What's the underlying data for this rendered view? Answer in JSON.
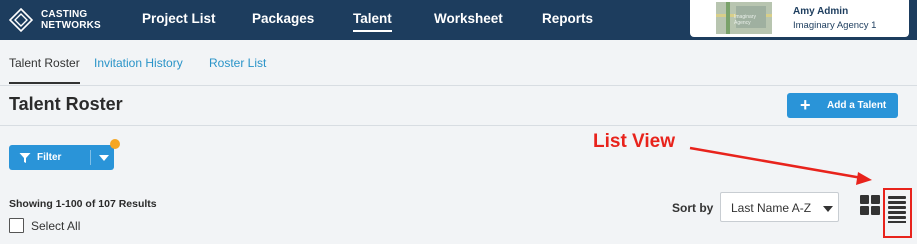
{
  "brand": {
    "line1": "CASTING",
    "line2": "NETWORKS",
    "icon": "casting-networks-logo-icon"
  },
  "nav": {
    "items": [
      {
        "label": "Project List",
        "active": false
      },
      {
        "label": "Packages",
        "active": false
      },
      {
        "label": "Talent",
        "active": true
      },
      {
        "label": "Worksheet",
        "active": false
      },
      {
        "label": "Reports",
        "active": false
      }
    ]
  },
  "account": {
    "name": "Amy Admin",
    "agency": "Imaginary Agency 1",
    "image_caption": "Imaginary Agency"
  },
  "subtabs": [
    {
      "label": "Talent Roster",
      "active": true
    },
    {
      "label": "Invitation History",
      "active": false
    },
    {
      "label": "Roster List",
      "active": false
    }
  ],
  "page": {
    "title": "Talent Roster",
    "add_button": "Add a Talent"
  },
  "filter": {
    "label": "Filter",
    "icon": "funnel-icon",
    "indicator_color": "#f5a623"
  },
  "annotation": {
    "text": "List View",
    "color": "#e8231c"
  },
  "results": {
    "summary": "Showing 1-100 of 107 Results",
    "select_all": "Select All"
  },
  "sort": {
    "label": "Sort by",
    "value": "Last Name A-Z"
  },
  "view_toggle": {
    "grid_icon": "grid-view-icon",
    "list_icon": "list-view-icon",
    "selected": "list"
  },
  "colors": {
    "nav_bg": "#1d3d5e",
    "accent": "#2a94d8",
    "link": "#2a94c8"
  }
}
